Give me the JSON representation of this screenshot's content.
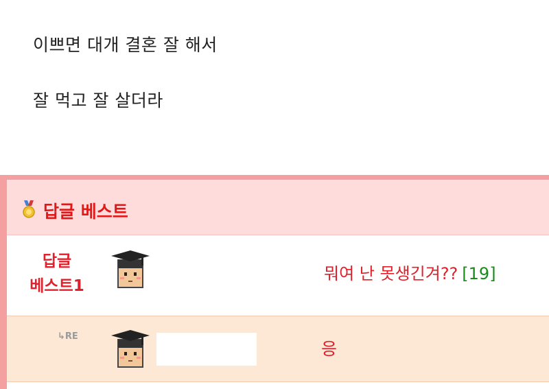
{
  "post": {
    "lines": [
      "이쁘면 대개 결혼 잘 해서",
      "잘 먹고 잘 살더라"
    ]
  },
  "best_replies": {
    "title": "답글 베스트",
    "items": [
      {
        "rank_line1": "답글",
        "rank_line2": "베스트1",
        "title": "뭐여 난 못생긴겨??",
        "comment_count": "[19]",
        "author_name": ""
      }
    ],
    "re_replies": [
      {
        "re_label": "↳RE",
        "title": "응",
        "author_name": ""
      }
    ]
  },
  "colors": {
    "panel_border": "#f5a0a0",
    "header_bg": "#ffdcdc",
    "accent_red": "#e0202a",
    "comment_count_green": "#1a8a1a",
    "reply_row_bg": "#fde7d5"
  },
  "icons": {
    "medal": "medal-icon",
    "avatar": "graduate-avatar-icon",
    "reply_arrow": "reply-arrow-icon"
  }
}
